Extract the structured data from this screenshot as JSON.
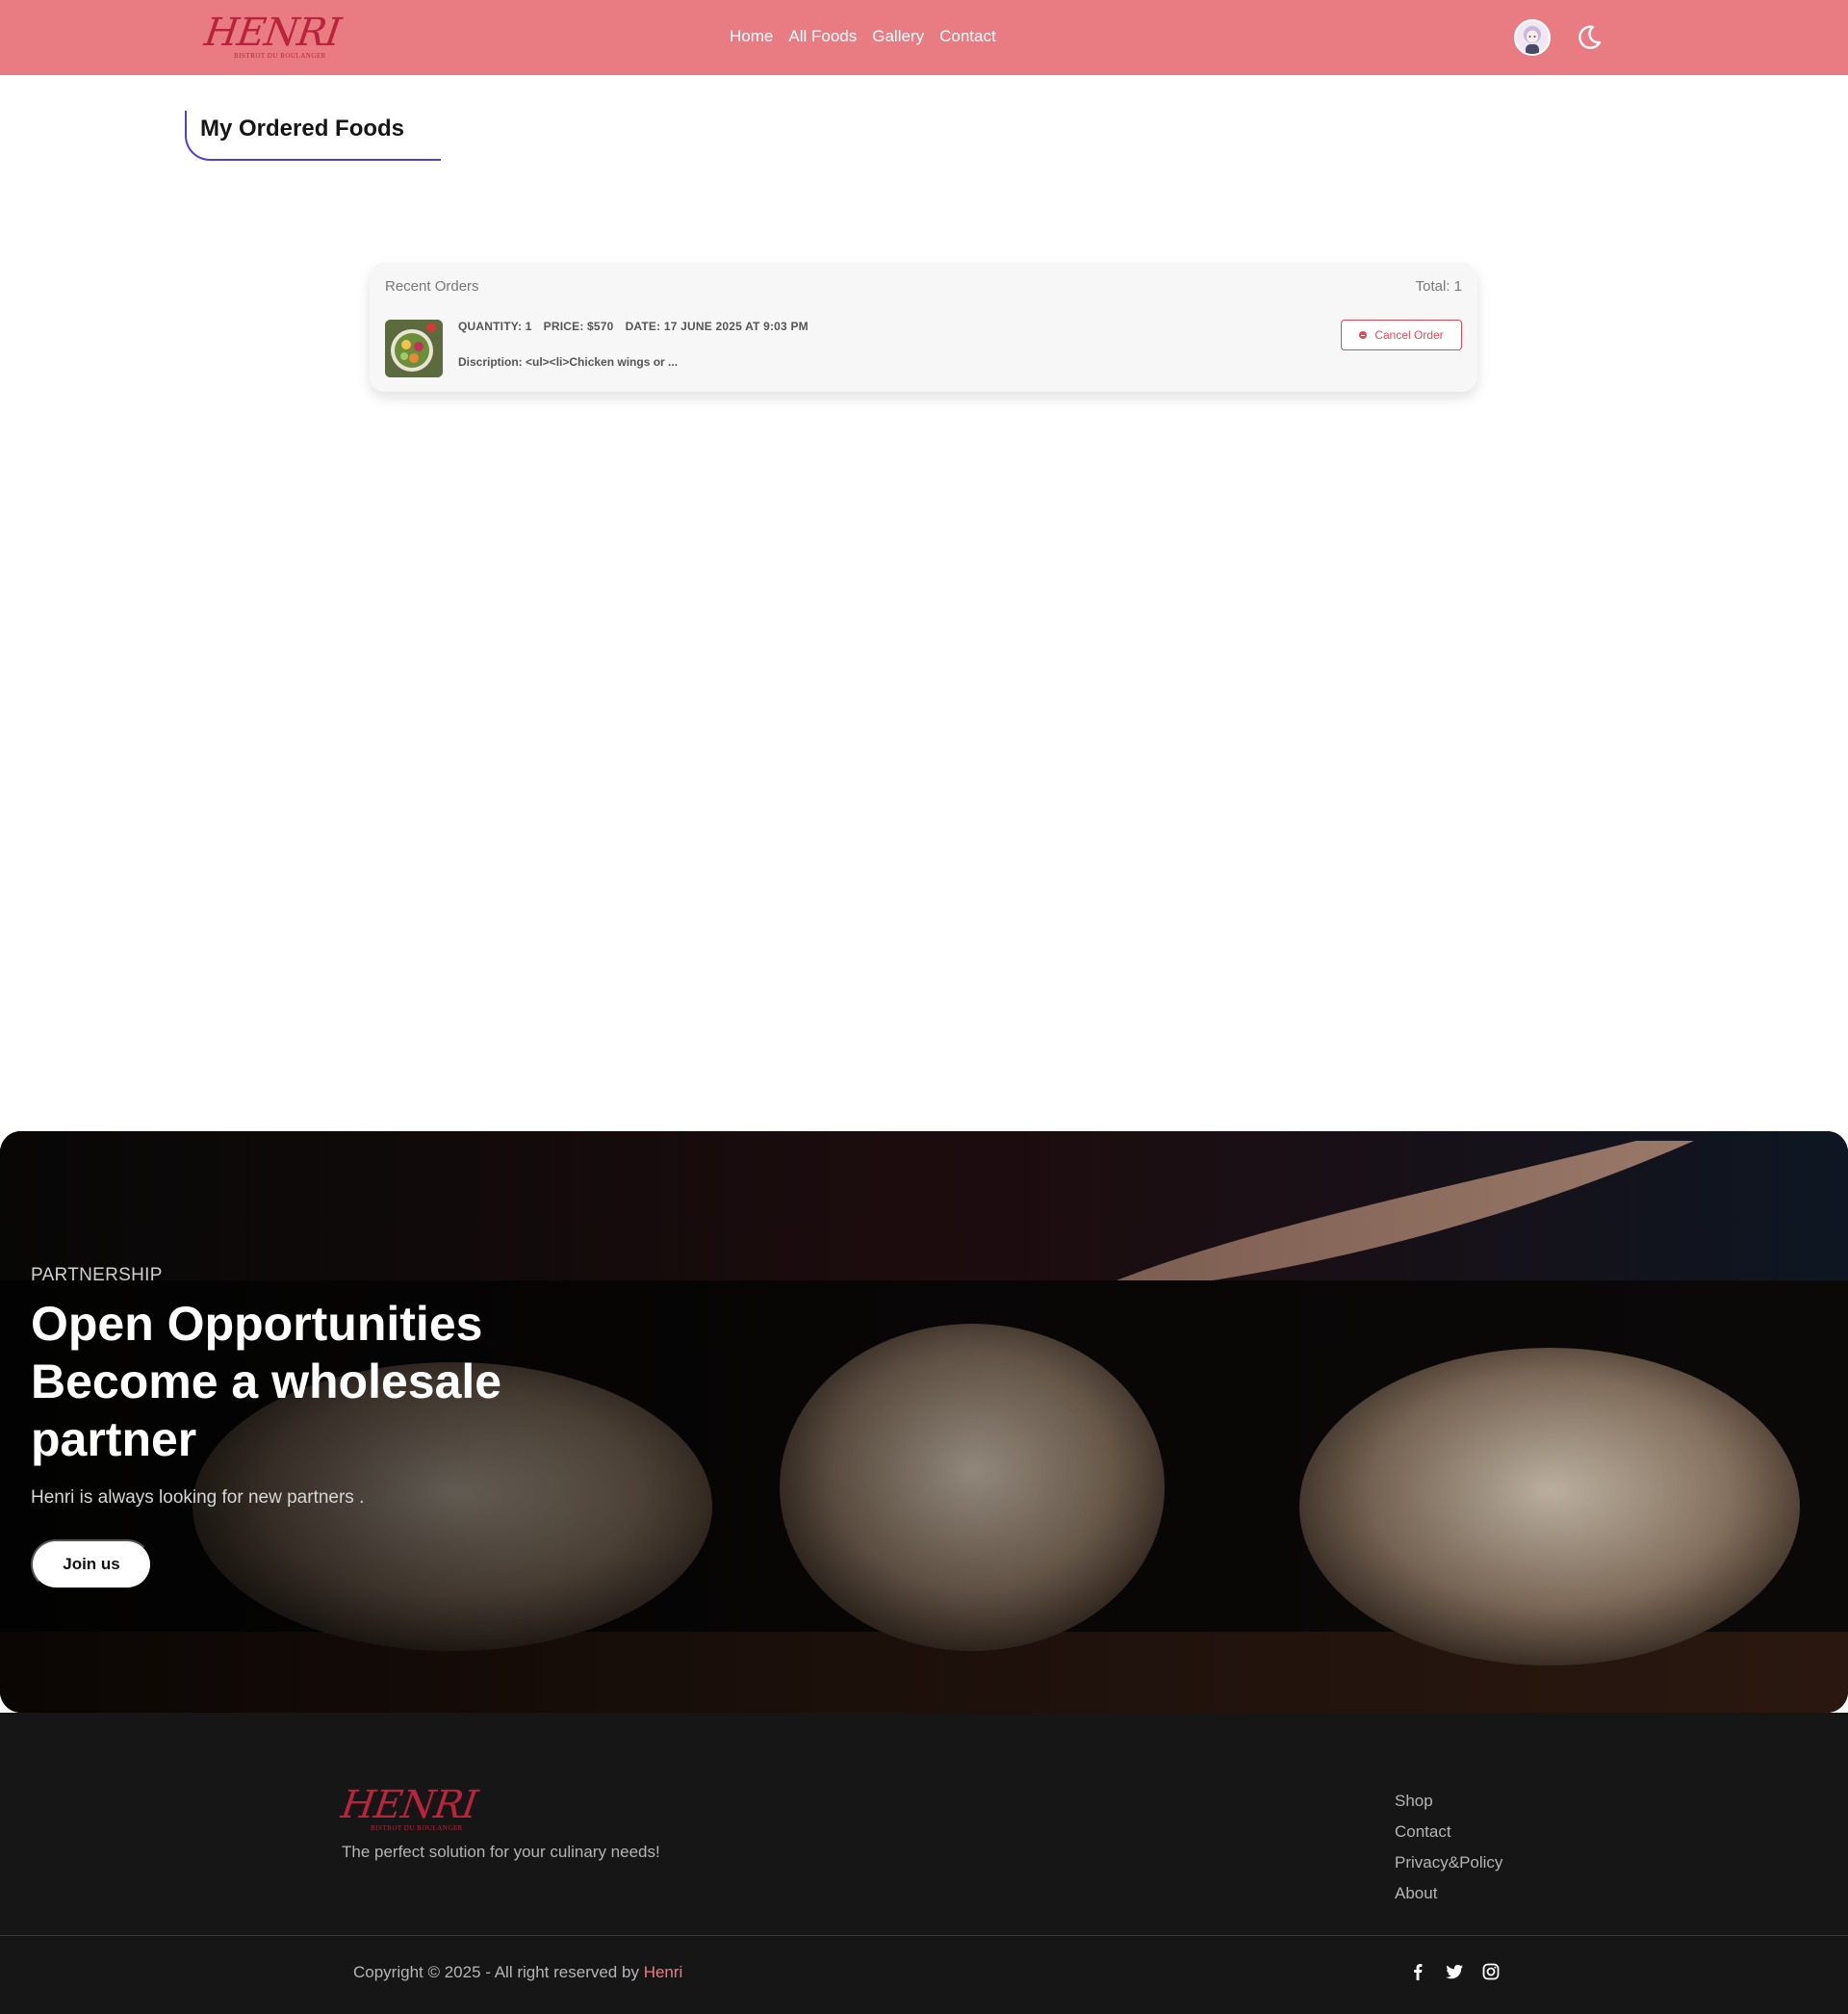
{
  "navbar": {
    "logo_text": "HENRI",
    "logo_subtext": "BISTROT DU BOULANGER",
    "links": [
      "Home",
      "All Foods",
      "Gallery",
      "Contact"
    ],
    "avatar_icon": "user-avatar-icon",
    "theme_icon": "moon-icon"
  },
  "page": {
    "title": "My Ordered Foods"
  },
  "orders": {
    "header_label": "Recent Orders",
    "total": "Total: 1",
    "items": [
      {
        "quantity": "QUANTITY: 1",
        "price": "PRICE: $570",
        "date": "DATE: 17 JUNE 2025 AT 9:03 PM",
        "description": "Discription: <ul><li>Chicken wings or ...",
        "cancel_label": "Cancel Order"
      }
    ]
  },
  "banner": {
    "eyebrow": "PARTNERSHIP",
    "title_line1": "Open Opportunities",
    "title_line2": "Become a wholesale",
    "title_line3": "partner",
    "subtitle": "Henri is always looking for new partners .",
    "button_label": "Join us"
  },
  "footer": {
    "logo_text": "HENRI",
    "logo_subtext": "BISTROT DU BOULANGER",
    "tagline": "The perfect solution for your culinary needs!",
    "links": [
      "Shop",
      "Contact",
      "Privacy&Policy",
      "About"
    ],
    "copyright_prefix": "Copyright © 2025 - All right reserved by",
    "copyright_brand": "Henri",
    "socials": [
      "facebook-icon",
      "twitter-icon",
      "instagram-icon"
    ]
  },
  "colors": {
    "navbar_bg": "#e97c82",
    "accent_red": "#e2485a",
    "heading_underline": "#4b3fd6",
    "footer_bg": "#161616"
  }
}
